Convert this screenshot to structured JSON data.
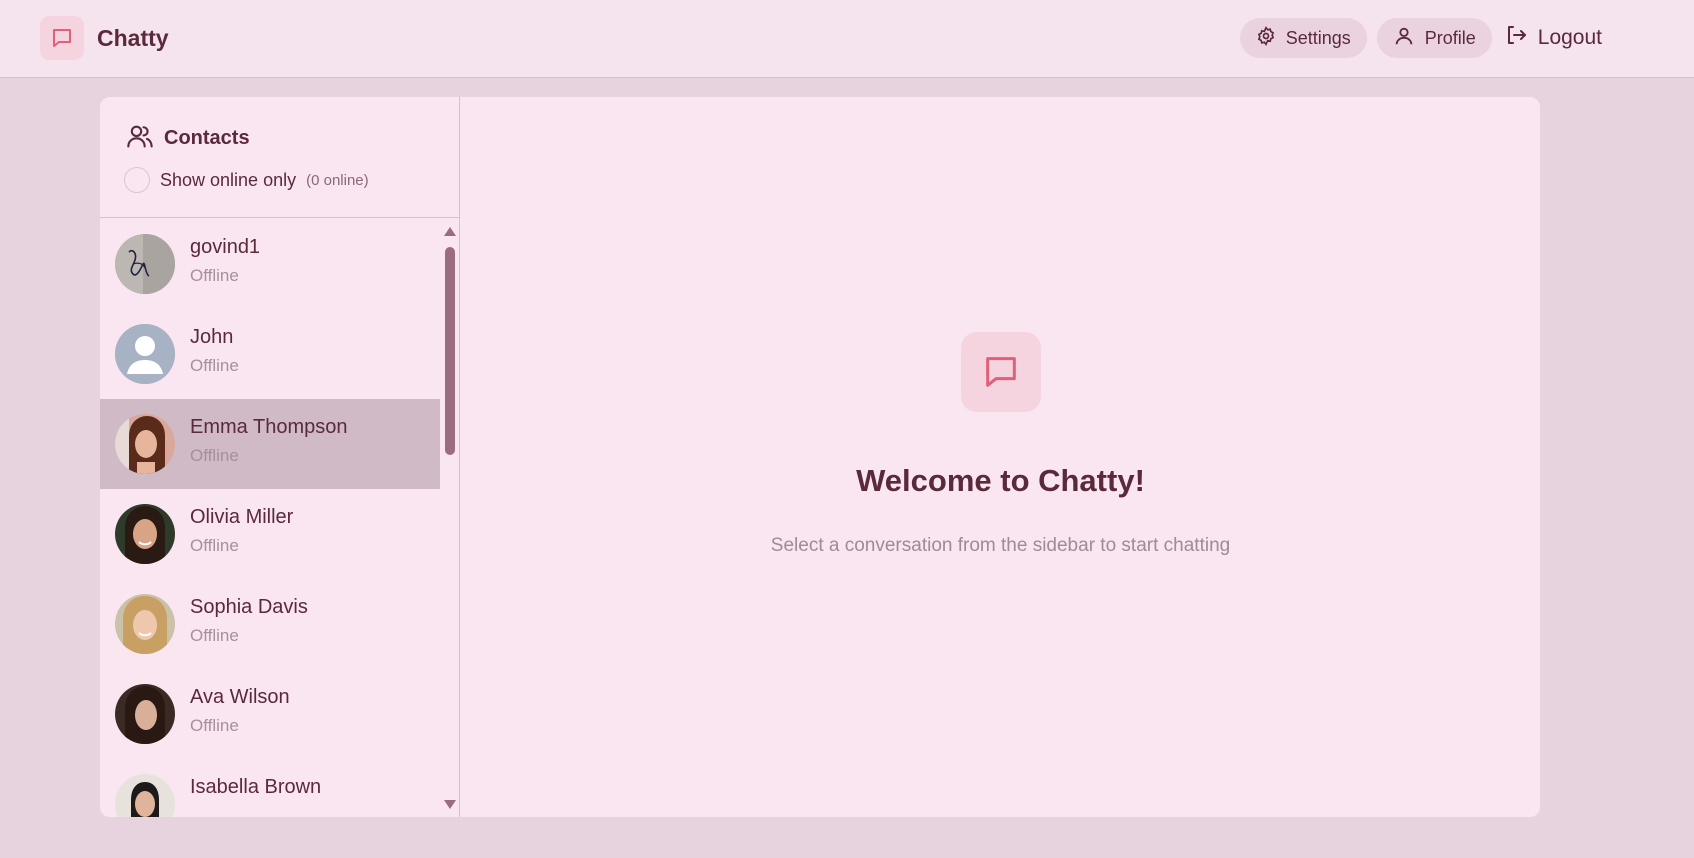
{
  "app": {
    "name": "Chatty"
  },
  "nav": {
    "settings_label": "Settings",
    "profile_label": "Profile",
    "logout_label": "Logout"
  },
  "sidebar": {
    "title": "Contacts",
    "filter_label": "Show online only",
    "online_count": "(0 online)",
    "contacts": [
      {
        "name": "govind1",
        "status": "Offline",
        "avatar": "signature-photo"
      },
      {
        "name": "John",
        "status": "Offline",
        "avatar": "default-avatar"
      },
      {
        "name": "Emma Thompson",
        "status": "Offline",
        "avatar": "photo",
        "selected": true
      },
      {
        "name": "Olivia Miller",
        "status": "Offline",
        "avatar": "photo"
      },
      {
        "name": "Sophia Davis",
        "status": "Offline",
        "avatar": "photo"
      },
      {
        "name": "Ava Wilson",
        "status": "Offline",
        "avatar": "photo"
      },
      {
        "name": "Isabella Brown",
        "status": "",
        "avatar": "photo"
      }
    ]
  },
  "welcome": {
    "title": "Welcome to Chatty!",
    "subtitle": "Select a conversation from the sidebar to start chatting"
  },
  "colors": {
    "primary_text": "#5a2a3c",
    "accent_icon": "#e0607a",
    "selected_row": "#cfbac6",
    "page_bg": "#e6d3de",
    "card_bg": "#f9e6f1"
  }
}
